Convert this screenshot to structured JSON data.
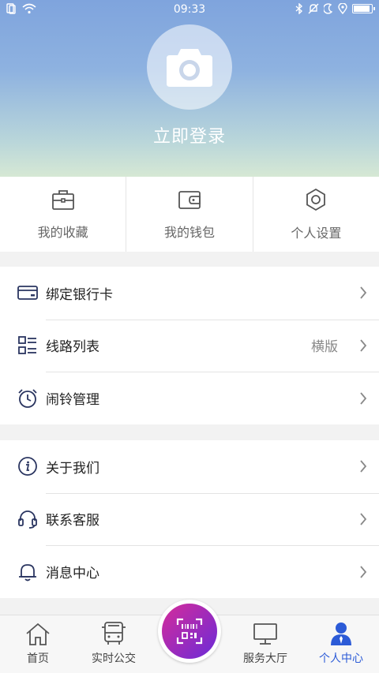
{
  "status_bar": {
    "time": "09:33"
  },
  "profile": {
    "login_label": "立即登录",
    "avatar_icon": "camera-icon"
  },
  "quick_actions": [
    {
      "label": "我的收藏",
      "icon": "briefcase-icon"
    },
    {
      "label": "我的钱包",
      "icon": "wallet-icon"
    },
    {
      "label": "个人设置",
      "icon": "gear-icon"
    }
  ],
  "menu_group_1": [
    {
      "label": "绑定银行卡",
      "value": "",
      "icon": "bank-card-icon"
    },
    {
      "label": "线路列表",
      "value": "横版",
      "icon": "list-icon"
    },
    {
      "label": "闹铃管理",
      "value": "",
      "icon": "alarm-clock-icon"
    }
  ],
  "menu_group_2": [
    {
      "label": "关于我们",
      "value": "",
      "icon": "info-icon"
    },
    {
      "label": "联系客服",
      "value": "",
      "icon": "headset-icon"
    },
    {
      "label": "消息中心",
      "value": "",
      "icon": "bell-icon"
    }
  ],
  "tabbar": {
    "items": [
      {
        "label": "首页",
        "icon": "home-icon"
      },
      {
        "label": "实时公交",
        "icon": "bus-icon"
      },
      {
        "label": "",
        "icon": "barcode-scan-icon"
      },
      {
        "label": "服务大厅",
        "icon": "monitor-icon"
      },
      {
        "label": "个人中心",
        "icon": "user-icon"
      }
    ],
    "active_index": 4
  },
  "colors": {
    "accent": "#2c5bd7",
    "scan_gradient_start": "#d62b9a",
    "scan_gradient_end": "#6a2bd8"
  }
}
